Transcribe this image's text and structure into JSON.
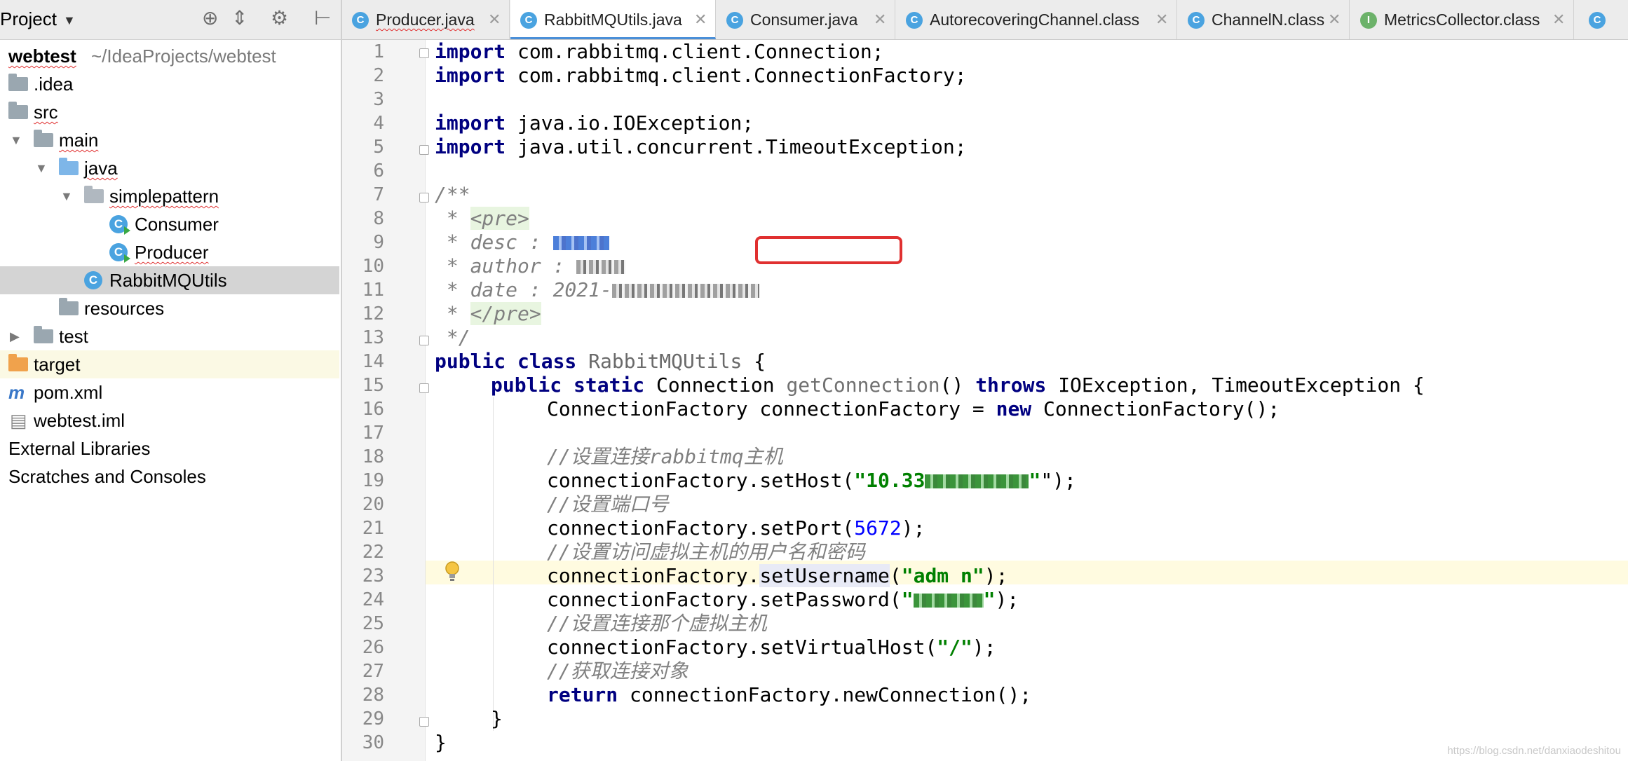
{
  "project_panel": {
    "title": "Project",
    "tree": [
      {
        "label": "webtest",
        "path": "~/IdeaProjects/webtest"
      },
      {
        "label": ".idea"
      },
      {
        "label": "src"
      },
      {
        "label": "main"
      },
      {
        "label": "java"
      },
      {
        "label": "simplepattern"
      },
      {
        "label": "Consumer"
      },
      {
        "label": "Producer"
      },
      {
        "label": "RabbitMQUtils"
      },
      {
        "label": "resources"
      },
      {
        "label": "test"
      },
      {
        "label": "target"
      },
      {
        "label": "pom.xml"
      },
      {
        "label": "webtest.iml"
      },
      {
        "label": "External Libraries"
      },
      {
        "label": "Scratches and Consoles"
      }
    ]
  },
  "tabs": [
    {
      "label": "Producer.java",
      "icon": "C"
    },
    {
      "label": "RabbitMQUtils.java",
      "icon": "C"
    },
    {
      "label": "Consumer.java",
      "icon": "C"
    },
    {
      "label": "AutorecoveringChannel.class",
      "icon": "C"
    },
    {
      "label": "ChannelN.class",
      "icon": "C"
    },
    {
      "label": "MetricsCollector.class",
      "icon": "I"
    }
  ],
  "editor": {
    "line_numbers": [
      "1",
      "2",
      "3",
      "4",
      "5",
      "6",
      "7",
      "8",
      "9",
      "10",
      "11",
      "12",
      "13",
      "14",
      "15",
      "16",
      "17",
      "18",
      "19",
      "20",
      "21",
      "22",
      "23",
      "24",
      "25",
      "26",
      "27",
      "28",
      "29",
      "30"
    ],
    "code": {
      "l1": "com.rabbitmq.client.Connection;",
      "l2": "com.rabbitmq.client.ConnectionFactory;",
      "l4": "java.io.IOException;",
      "l5": "java.util.concurrent.TimeoutException;",
      "l7": "/**",
      "l8_pre": " * ",
      "l8_tag": "<pre>",
      "l9": " * desc :",
      "l10": " * author :",
      "l11": " * date : 2021-",
      "l12_pre": " * ",
      "l12_tag": "</pre>",
      "l13": " */",
      "l14_kw": "public class",
      "l14_name": "RabbitMQUtils",
      "l14_end": " {",
      "l15_kw": "public static",
      "l15_type": " Connection ",
      "l15_fn": "getConnection",
      "l15_mid": "() ",
      "l15_throws": "throws",
      "l15_end": " IOException, TimeoutException {",
      "l16_a": "ConnectionFactory connectionFactory = ",
      "l16_new": "new",
      "l16_b": " ConnectionFactory();",
      "l18": "//设置连接rabbitmq主机",
      "l19_a": "connectionFactory.setHost(",
      "l19_str": "\"10.33",
      "l19_b": "\");",
      "l20": "//设置端口号",
      "l21_a": "connectionFactory.setPort(",
      "l21_num": "5672",
      "l21_b": ");",
      "l22": "//设置访问虚拟主机的用户名和密码",
      "l23_a": "connectionFactory.",
      "l23_m": "setUsername",
      "l23_b": "(",
      "l23_str": "\"adm n\"",
      "l23_c": ");",
      "l24_a": "connectionFactory.setPassword(",
      "l24_b": ");",
      "l25": "//设置连接那个虚拟主机",
      "l26_a": "connectionFactory.setVirtualHost(",
      "l26_str": "\"/\"",
      "l26_b": ");",
      "l27": "//获取连接对象",
      "l28_kw": "return",
      "l28_b": " connectionFactory.newConnection();",
      "l29": "}",
      "l30": "}",
      "import_kw": "import"
    }
  },
  "watermark": "https://blog.csdn.net/danxiaodeshitou",
  "colors": {
    "keyword": "#000080",
    "string": "#008000",
    "number": "#0000ff",
    "comment": "#808080",
    "highlight_box": "#e03030"
  }
}
